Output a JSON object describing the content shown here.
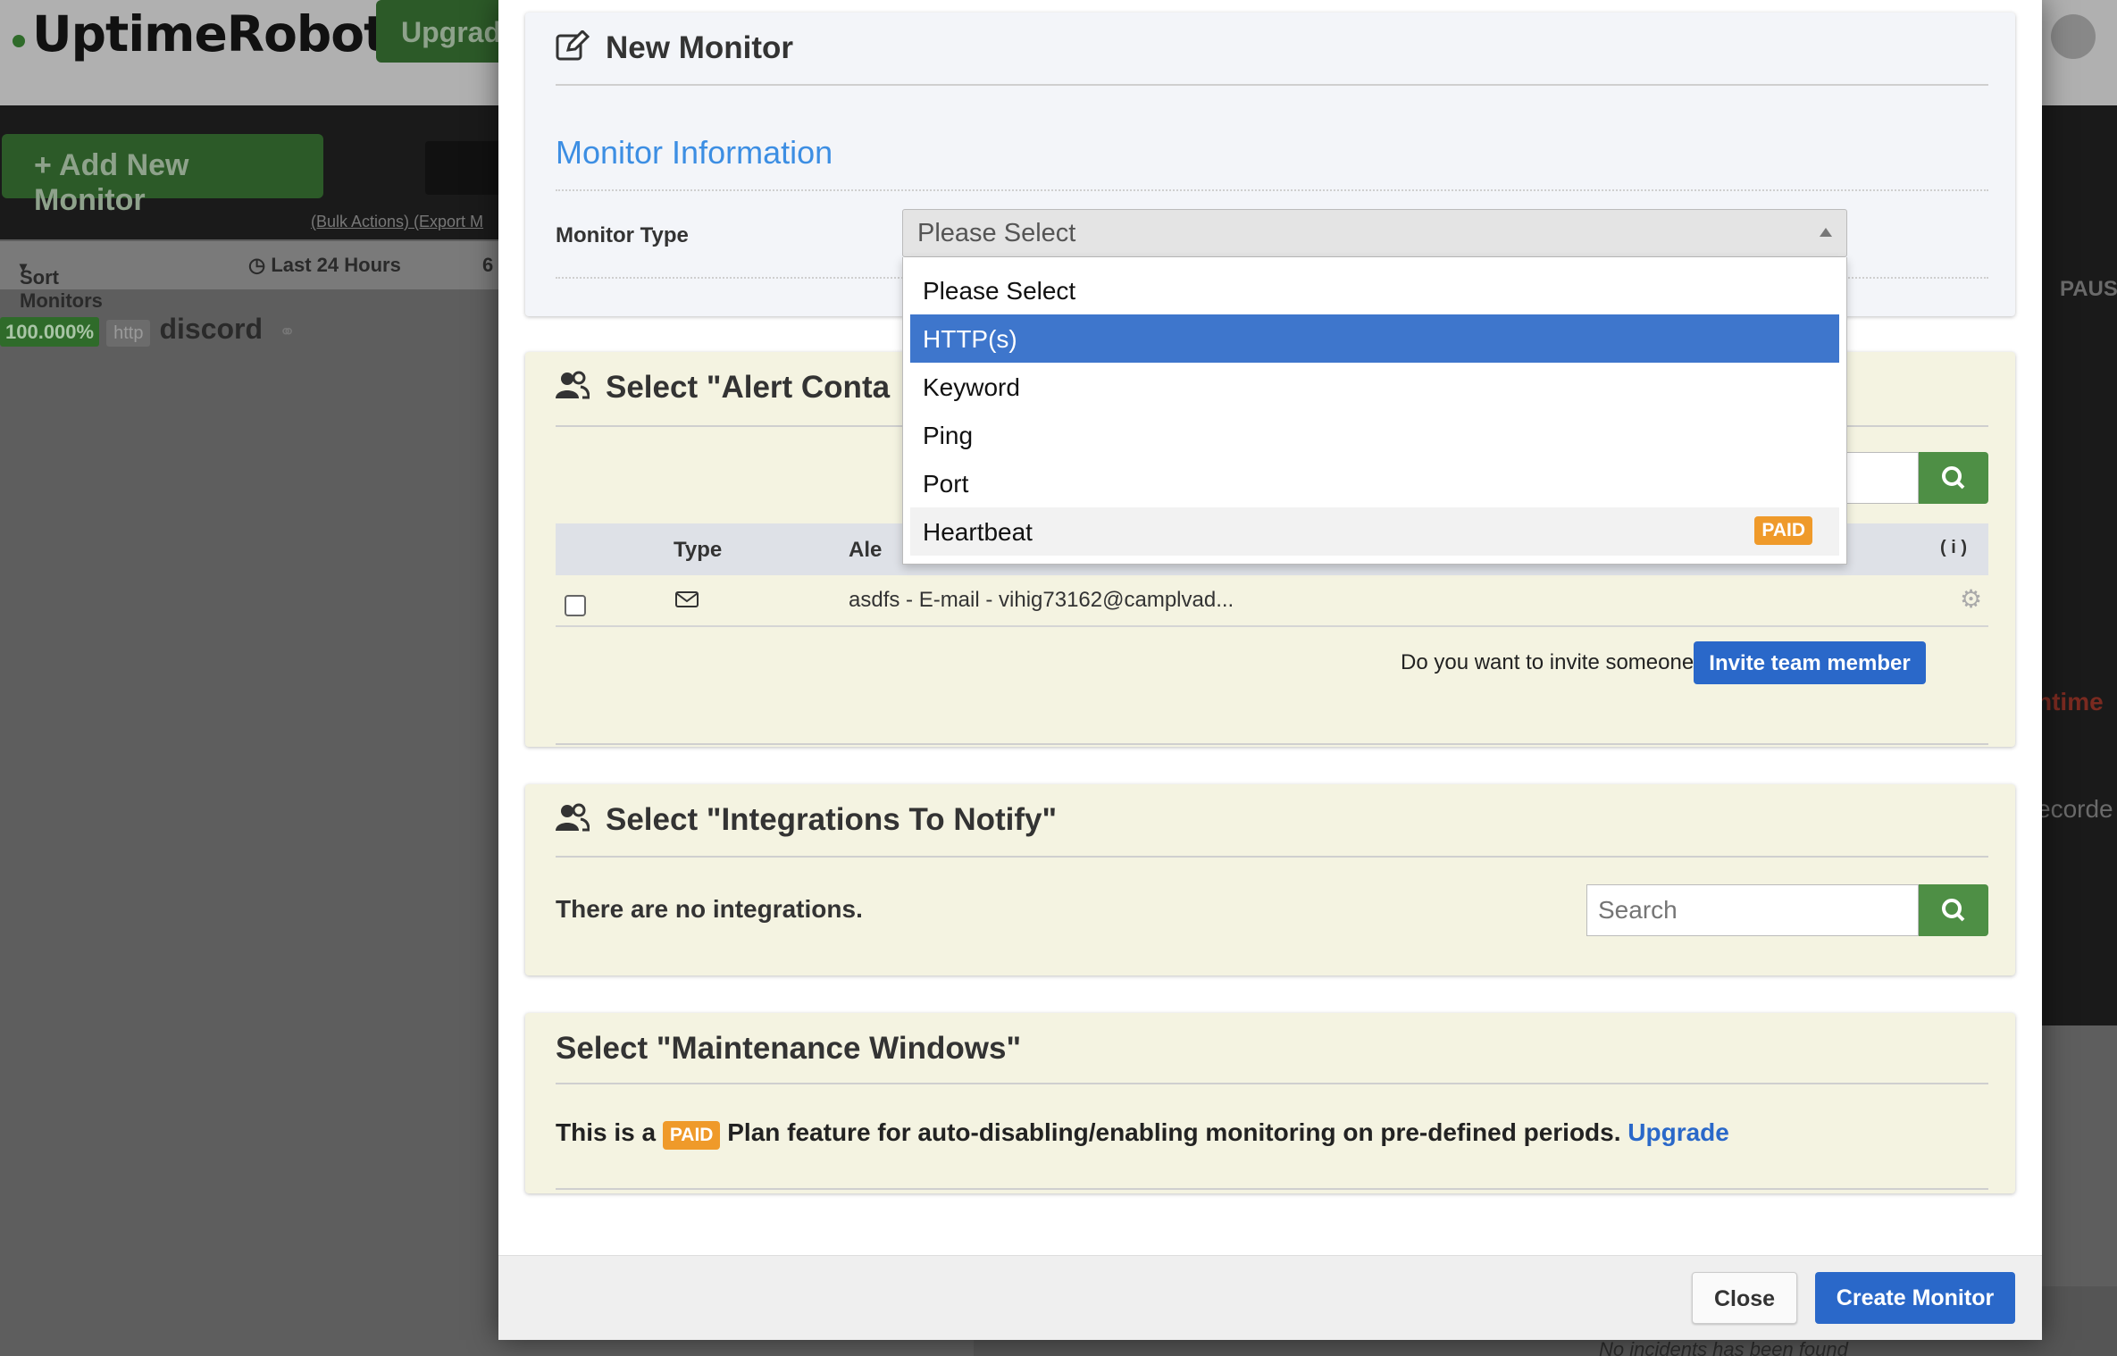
{
  "background": {
    "logo": "UptimeRobot",
    "upgrade_label": "Upgrad",
    "add_monitor_label": "+ Add New Monitor",
    "bulk_actions": "(Bulk Actions) (Export M",
    "sort_monitors": "Sort Monitors",
    "last_24": "Last 24 Hours",
    "col_6": "6",
    "monitor_pct": "100.000%",
    "monitor_type": "http",
    "monitor_name": "discord",
    "right_paus": "PAUS",
    "right_uptime": "ntime",
    "right_recorded": "ecorde",
    "bottom_text": "No incidents has been found"
  },
  "modal": {
    "title": "New Monitor",
    "monitor_info": {
      "section_title": "Monitor Information",
      "type_label": "Monitor Type",
      "selected": "Please Select",
      "options": [
        {
          "label": "Please Select"
        },
        {
          "label": "HTTP(s)"
        },
        {
          "label": "Keyword"
        },
        {
          "label": "Ping"
        },
        {
          "label": "Port"
        },
        {
          "label": "Heartbeat",
          "badge": "PAID"
        }
      ]
    },
    "alert_contacts": {
      "title": "Select \"Alert Conta",
      "col_type": "Type",
      "col_alert": "Ale",
      "col_info": "( i )",
      "row_contact": "asdfs - E-mail - vihig73162@camplvad...",
      "invite_question": "Do you want to invite someone from your team?",
      "invite_button": "Invite team member"
    },
    "integrations": {
      "title": "Select \"Integrations To Notify\"",
      "empty_text": "There are no integrations.",
      "search_placeholder": "Search"
    },
    "maintenance": {
      "title": "Select \"Maintenance Windows\"",
      "text_before": "This is a",
      "badge": "PAID",
      "text_after": "Plan feature for auto-disabling/enabling monitoring on pre-defined periods.",
      "upgrade_link": "Upgrade"
    },
    "footer": {
      "close_label": "Close",
      "create_label": "Create Monitor"
    }
  },
  "colors": {
    "accent_blue": "#2a68c9",
    "section_blue": "#3c8ee3",
    "paid_orange": "#ef9a2a",
    "search_green": "#4e8f45"
  }
}
